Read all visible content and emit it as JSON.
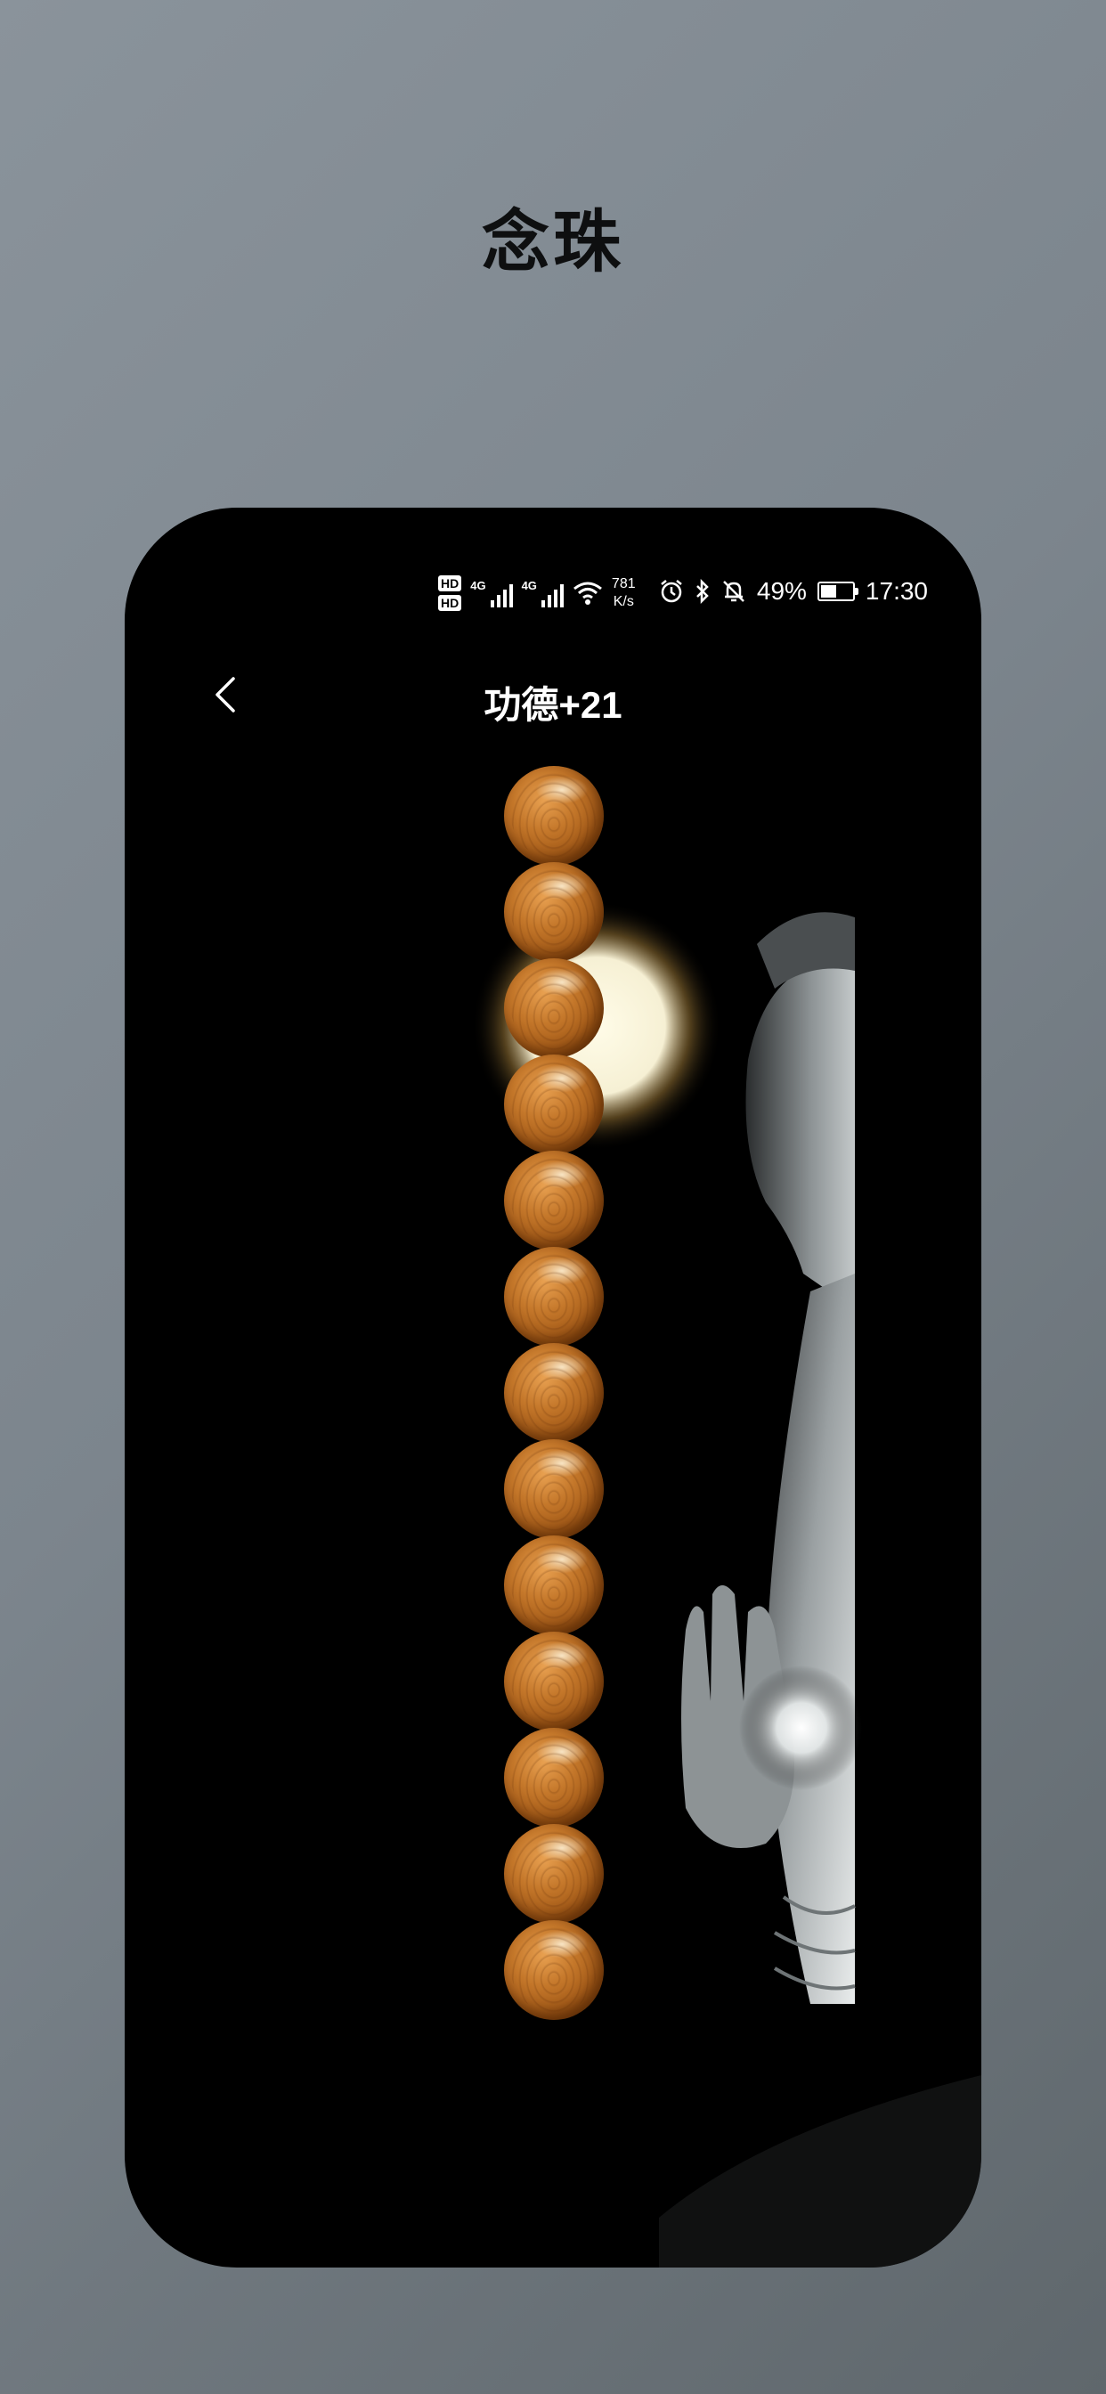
{
  "promo": {
    "title": "念珠"
  },
  "status_bar": {
    "hd_top": "HD",
    "hd_bottom": "HD",
    "signal_1_label": "4G",
    "signal_2_label": "4G",
    "net_speed_value": "781",
    "net_speed_unit": "K/s",
    "battery_percent": "49%",
    "time": "17:30",
    "icons": [
      "hd-icon",
      "signal-icon",
      "wifi-icon",
      "alarm-icon",
      "bluetooth-icon",
      "mute-icon",
      "battery-icon"
    ]
  },
  "nav": {
    "back_icon": "chevron-left-icon",
    "title": "功德+21"
  },
  "beads": {
    "count_visible": 13,
    "colors": {
      "bead_light": "#e8a050",
      "bead_dark": "#6a3308"
    }
  },
  "colors": {
    "background_gradient": [
      "#8a939b",
      "#5f676c"
    ],
    "phone_background": "#000000",
    "text_on_dark": "#ffffff",
    "promo_title": "#0e0f10"
  }
}
